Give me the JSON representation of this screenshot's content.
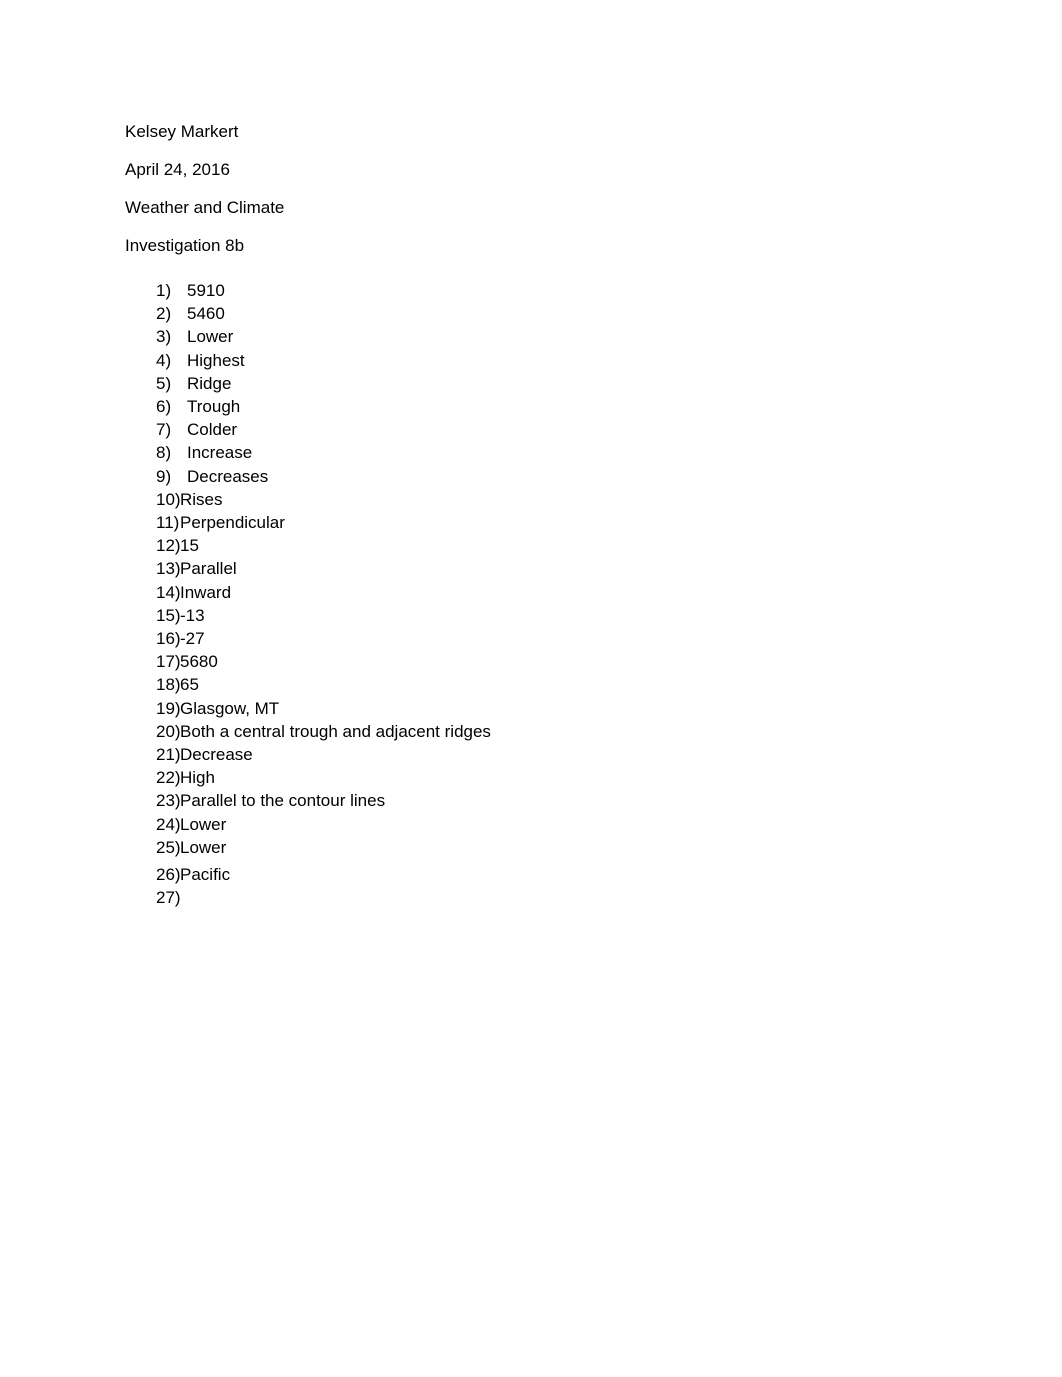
{
  "document": {
    "header_lines": [
      "Kelsey Markert",
      "April 24, 2016",
      "Weather and Climate",
      "Investigation 8b"
    ],
    "answers": [
      {
        "marker": "1)",
        "text": "5910"
      },
      {
        "marker": "2)",
        "text": "5460"
      },
      {
        "marker": "3)",
        "text": "Lower"
      },
      {
        "marker": "4)",
        "text": "Highest"
      },
      {
        "marker": "5)",
        "text": "Ridge"
      },
      {
        "marker": "6)",
        "text": "Trough"
      },
      {
        "marker": "7)",
        "text": "Colder"
      },
      {
        "marker": "8)",
        "text": "Increase"
      },
      {
        "marker": "9)",
        "text": "Decreases"
      },
      {
        "marker": "10)",
        "text": "Rises"
      },
      {
        "marker": "11)",
        "text": "Perpendicular"
      },
      {
        "marker": "12)",
        "text": "15"
      },
      {
        "marker": "13)",
        "text": "Parallel"
      },
      {
        "marker": "14)",
        "text": "Inward"
      },
      {
        "marker": "15)",
        "text": "-13"
      },
      {
        "marker": "16)",
        "text": "-27"
      },
      {
        "marker": "17)",
        "text": "5680"
      },
      {
        "marker": "18)",
        "text": "65"
      },
      {
        "marker": "19)",
        "text": "Glasgow, MT"
      },
      {
        "marker": "20)",
        "text": "Both a central trough and adjacent ridges"
      },
      {
        "marker": "21)",
        "text": "Decrease"
      },
      {
        "marker": "22)",
        "text": "High"
      },
      {
        "marker": "23)",
        "text": "Parallel to the contour lines"
      },
      {
        "marker": "24)",
        "text": "Lower"
      },
      {
        "marker": "25)",
        "text": "Lower"
      },
      {
        "marker": "26)",
        "text": "Pacific"
      },
      {
        "marker": "27)",
        "text": ""
      }
    ]
  }
}
